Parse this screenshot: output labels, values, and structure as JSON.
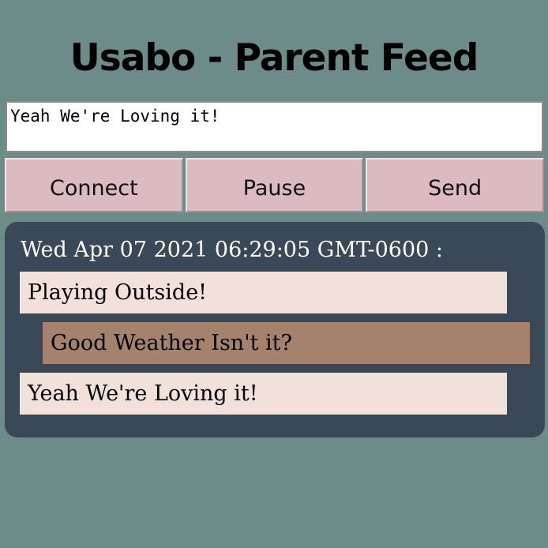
{
  "header": {
    "title": "Usabo - Parent Feed"
  },
  "composer": {
    "value": "Yeah We're Loving it!"
  },
  "buttons": {
    "connect": "Connect",
    "pause": "Pause",
    "send": "Send"
  },
  "feed": {
    "timestamp": "Wed Apr 07 2021 06:29:05 GMT-0600 :",
    "messages": [
      {
        "text": "Playing Outside!",
        "sender": "self"
      },
      {
        "text": "Good Weather Isn't it?",
        "sender": "other"
      },
      {
        "text": "Yeah We're Loving it!",
        "sender": "self"
      }
    ]
  },
  "colors": {
    "background": "#6c8b89",
    "button": "#dbbac0",
    "feed_panel": "#3b4858",
    "own_message": "#f2e0da",
    "other_message": "#a5826e"
  }
}
